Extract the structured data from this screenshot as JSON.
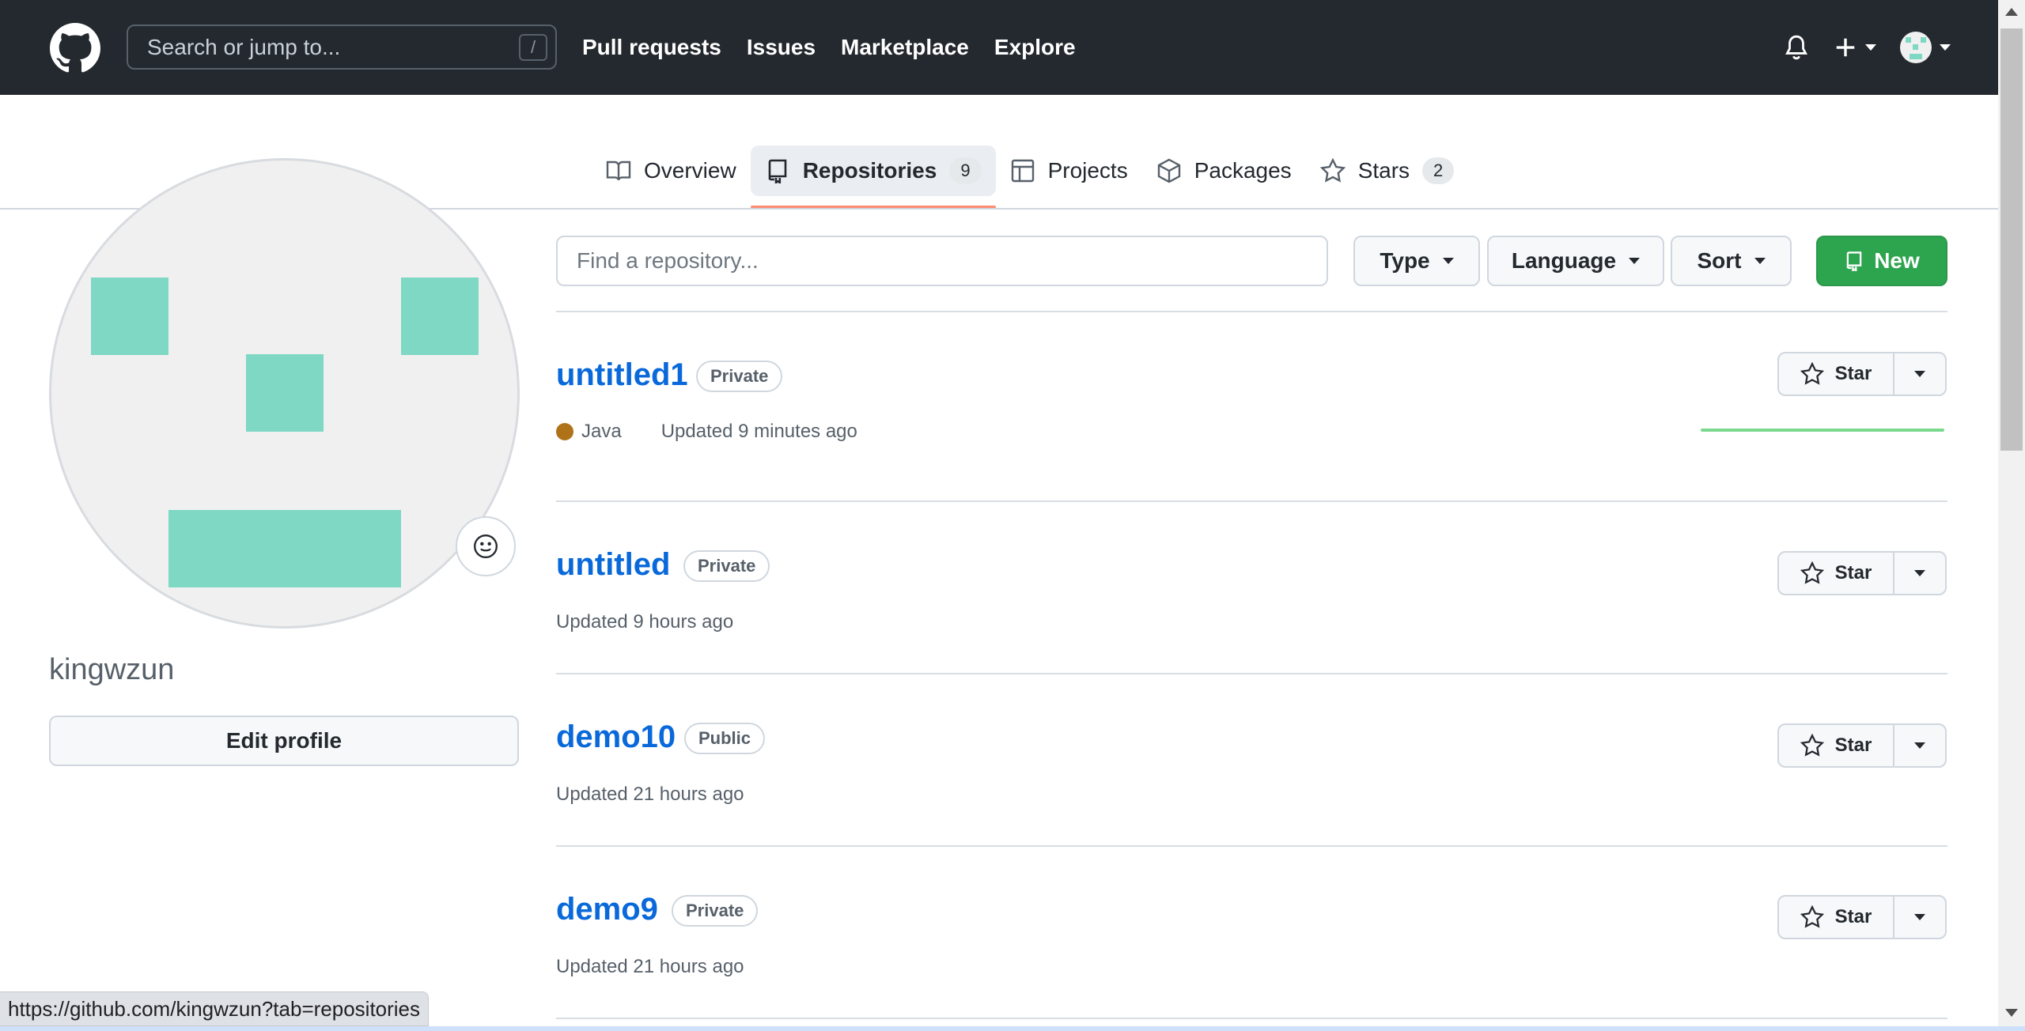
{
  "header": {
    "search_placeholder": "Search or jump to...",
    "search_shortcut": "/",
    "nav": [
      "Pull requests",
      "Issues",
      "Marketplace",
      "Explore"
    ]
  },
  "tabs": {
    "overview": "Overview",
    "repositories": "Repositories",
    "repositories_count": "9",
    "projects": "Projects",
    "packages": "Packages",
    "stars": "Stars",
    "stars_count": "2"
  },
  "profile": {
    "username": "kingwzun",
    "edit_label": "Edit profile"
  },
  "filters": {
    "find_placeholder": "Find a repository...",
    "type": "Type",
    "language": "Language",
    "sort": "Sort",
    "new": "New"
  },
  "repos": [
    {
      "name": "untitled1",
      "visibility": "Private",
      "language": "Java",
      "updated": "Updated 9 minutes ago",
      "star": "Star"
    },
    {
      "name": "untitled",
      "visibility": "Private",
      "updated": "Updated 9 hours ago",
      "star": "Star"
    },
    {
      "name": "demo10",
      "visibility": "Public",
      "updated": "Updated 21 hours ago",
      "star": "Star"
    },
    {
      "name": "demo9",
      "visibility": "Private",
      "updated": "Updated 21 hours ago",
      "star": "Star"
    }
  ],
  "status_url": "https://github.com/kingwzun?tab=repositories",
  "colors": {
    "header": "#24292f",
    "link": "#0969da",
    "new_button": "#2da44e",
    "java": "#b07219",
    "identicon": "#7fd8c4"
  }
}
